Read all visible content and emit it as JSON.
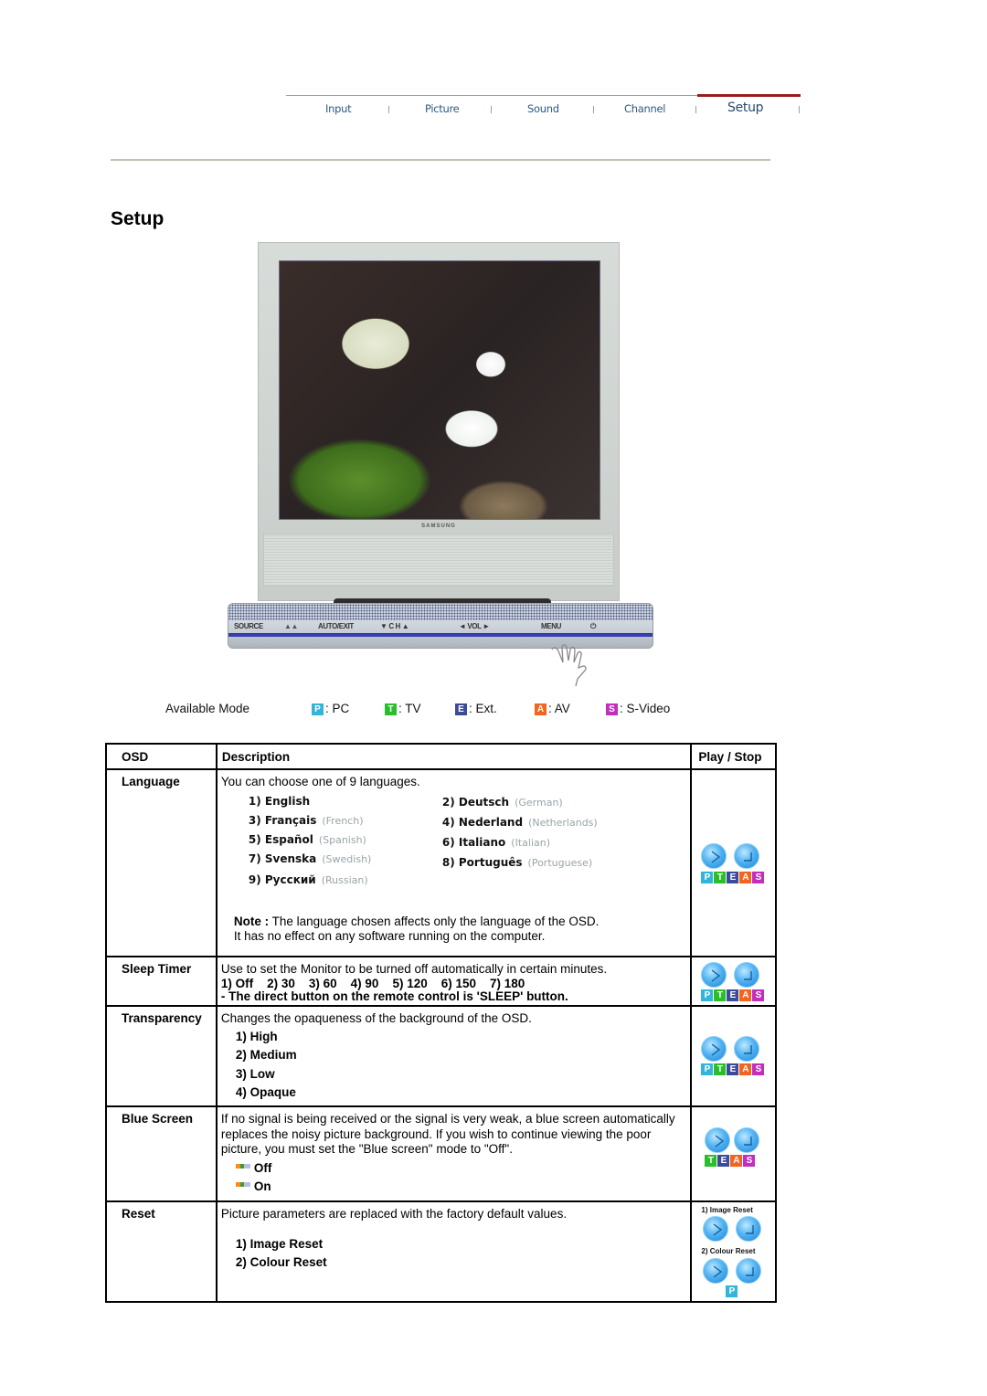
{
  "nav": {
    "items": [
      {
        "label": "Input"
      },
      {
        "label": "Picture"
      },
      {
        "label": "Sound"
      },
      {
        "label": "Channel"
      },
      {
        "label": "Setup",
        "active": true
      }
    ],
    "active_color": "#9b1b1f"
  },
  "page": {
    "title": "Setup"
  },
  "monitor": {
    "brand": "SAMSUNG",
    "panel_labels": [
      "SOURCE",
      "AUTO/EXIT",
      "▼ C H ▲",
      "◄  VOL  ►",
      "MENU",
      "⏻"
    ]
  },
  "available_mode": {
    "label": "Available Mode",
    "modes": [
      {
        "badge": "P",
        "label": ": PC",
        "color": "#33b5d9"
      },
      {
        "badge": "T",
        "label": ": TV",
        "color": "#2bbd2b"
      },
      {
        "badge": "E",
        "label": ": Ext.",
        "color": "#3c4a9a"
      },
      {
        "badge": "A",
        "label": ": AV",
        "color": "#f2641f"
      },
      {
        "badge": "S",
        "label": ": S-Video",
        "color": "#c22fbf"
      }
    ]
  },
  "table": {
    "headers": {
      "osd": "OSD",
      "description": "Description",
      "play": "Play / Stop"
    },
    "rows": [
      {
        "name": "Language",
        "description": "You can choose one of 9 languages.",
        "languages": [
          {
            "native": "1) English",
            "english": ""
          },
          {
            "native": "2) Deutsch",
            "english": "(German)"
          },
          {
            "native": "3) Français",
            "english": "(French)"
          },
          {
            "native": "4) Nederland",
            "english": "(Netherlands)"
          },
          {
            "native": "5) Español",
            "english": "(Spanish)"
          },
          {
            "native": "6) Italiano",
            "english": "(Italian)"
          },
          {
            "native": "7) Svenska",
            "english": "(Swedish)"
          },
          {
            "native": "8) Português",
            "english": "(Portuguese)"
          },
          {
            "native": "9) Русский",
            "english": "(Russian)"
          }
        ],
        "note_label": "Note :",
        "note_text": " The language chosen affects only the language of the OSD.",
        "note_text2": "It has no effect on any software running on the computer.",
        "modes": "PTEAS"
      },
      {
        "name": "Sleep Timer",
        "description": "Use to set the Monitor to be turned off automatically in certain minutes.",
        "options_line": "1) Off    2) 30    3) 60    4) 90    5) 120    6) 150    7) 180",
        "extra": "- The direct button on the remote control is 'SLEEP' button.",
        "modes": "PTEAS"
      },
      {
        "name": "Transparency",
        "description": "Changes the opaqueness of the background of the OSD.",
        "options": [
          "1) High",
          "2) Medium",
          "3) Low",
          "4) Opaque"
        ],
        "modes": "PTEAS"
      },
      {
        "name": "Blue Screen",
        "description": "If no signal is being received or the signal is very weak, a blue screen automatically replaces the noisy picture background. If you wish to continue viewing the poor picture, you must set the \"Blue screen\" mode to \"Off\".",
        "options": [
          "Off",
          "On"
        ],
        "modes": "TEAS"
      },
      {
        "name": "Reset",
        "description": "Picture parameters are replaced with the factory default values.",
        "options": [
          "1) Image Reset",
          "2) Colour Reset"
        ],
        "play_labels": [
          "1) Image Reset",
          "2) Colour Reset"
        ],
        "modes": "P"
      }
    ]
  }
}
